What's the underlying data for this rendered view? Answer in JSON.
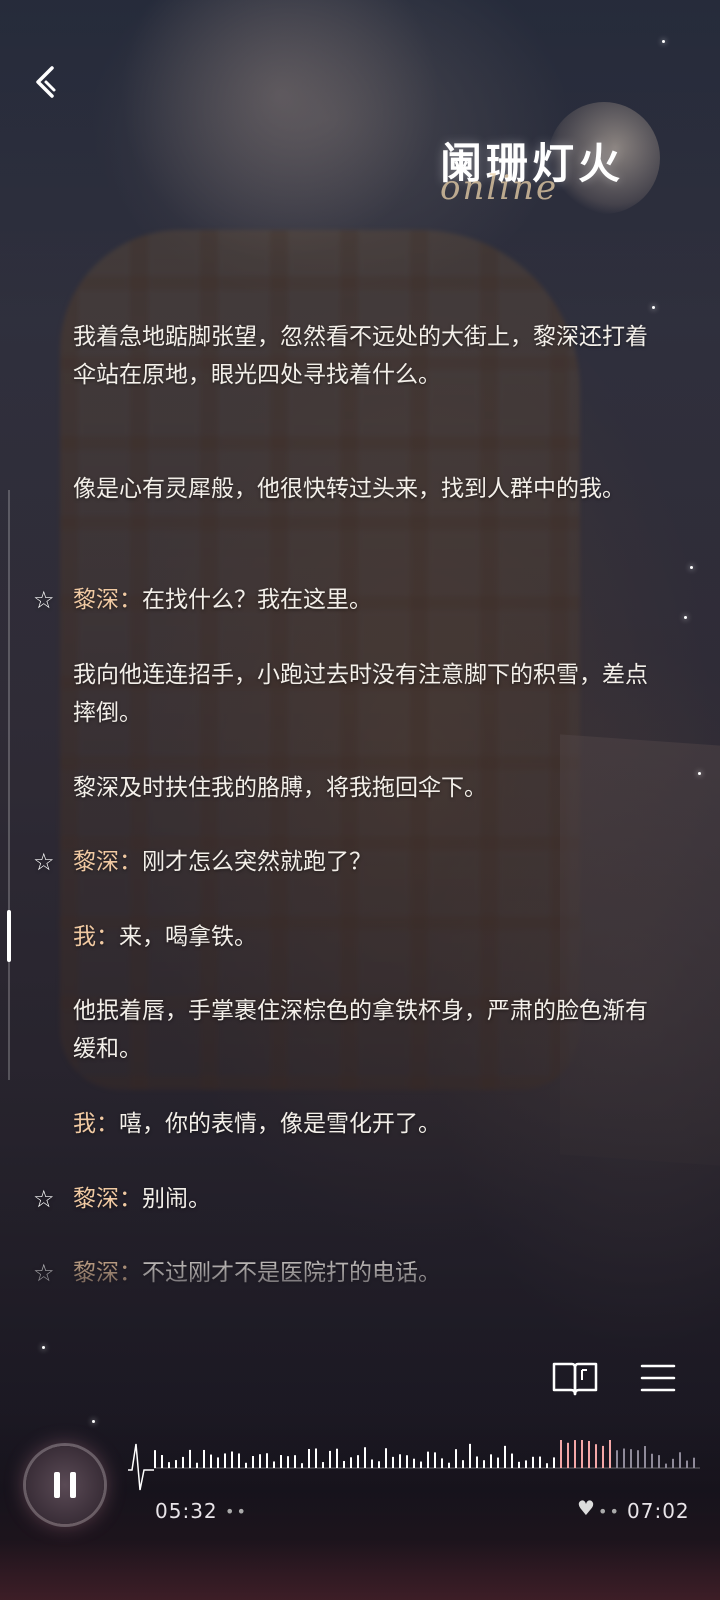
{
  "header": {
    "logo_title": "阑珊灯火",
    "logo_subtitle": "online"
  },
  "story": {
    "lines": [
      {
        "type": "narration",
        "text": "我着急地踮脚张望，忽然看不远处的大街上，黎深还打着伞站在原地，眼光四处寻找着什么。"
      },
      {
        "type": "narration",
        "text": "像是心有灵犀般，他很快转过头来，找到人群中的我。"
      },
      {
        "type": "dialogue",
        "speaker": "黎深：",
        "text": "在找什么？我在这里。",
        "star": true
      },
      {
        "type": "narration",
        "text": "我向他连连招手，小跑过去时没有注意脚下的积雪，差点摔倒。"
      },
      {
        "type": "narration",
        "text": "黎深及时扶住我的胳膊，将我拖回伞下。"
      },
      {
        "type": "dialogue",
        "speaker": "黎深：",
        "text": "刚才怎么突然就跑了？",
        "star": true
      },
      {
        "type": "dialogue",
        "speaker": "我：",
        "text": "来，喝拿铁。",
        "star": false
      },
      {
        "type": "narration",
        "text": "他抿着唇，手掌裹住深棕色的拿铁杯身，严肃的脸色渐有缓和。"
      },
      {
        "type": "dialogue",
        "speaker": "我：",
        "text": "嘻，你的表情，像是雪化开了。",
        "star": false
      },
      {
        "type": "dialogue",
        "speaker": "黎深：",
        "text": "别闹。",
        "star": true
      },
      {
        "type": "dialogue",
        "speaker": "黎深：",
        "text": "不过刚才不是医院打的电话。",
        "star": true
      }
    ]
  },
  "icons": {
    "back": "chevron-left-icon",
    "star": "star-outline-icon",
    "book": "book-icon",
    "menu": "menu-icon",
    "pause": "pause-icon",
    "heart": "heart-icon"
  },
  "player": {
    "current_time": "05:32",
    "total_time": "07:02",
    "progress": 0.786,
    "current_dots": "••",
    "end_dots": "••"
  },
  "colors": {
    "speaker": "#f0c9a2",
    "text": "#f3efe9",
    "wave_played": "#ffffff",
    "wave_highlight": "#f4a7a7",
    "wave_rest": "#8f8a99"
  }
}
